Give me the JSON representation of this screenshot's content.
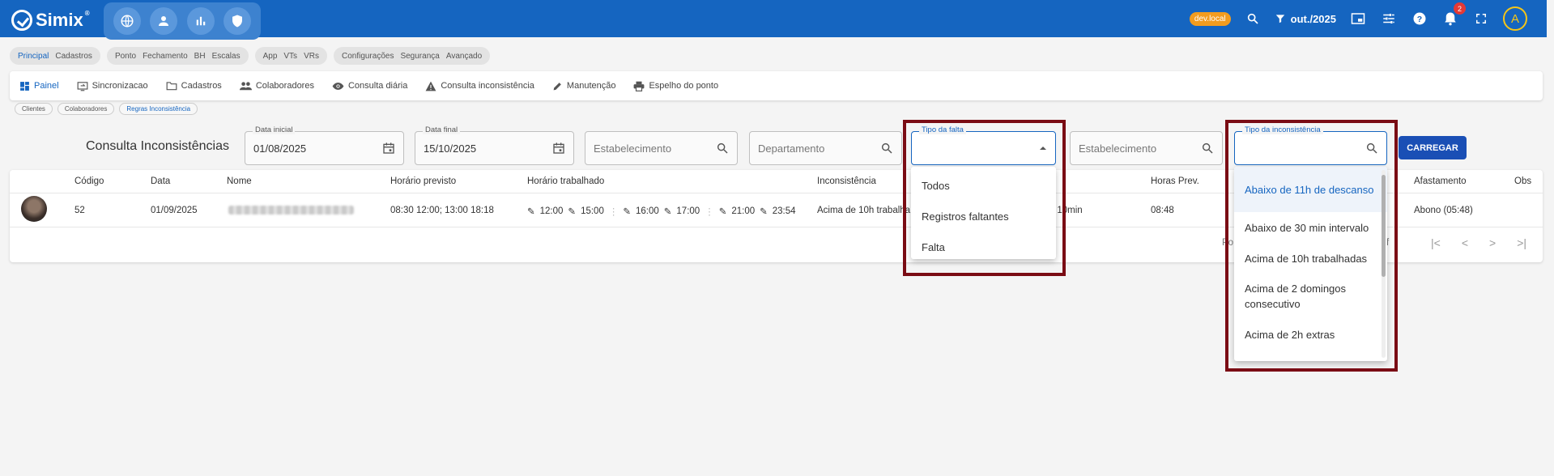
{
  "app": {
    "name": "Simix",
    "logo_sup": "®"
  },
  "topbar": {
    "env_badge": "dev.local",
    "month": "out./2025",
    "notifications": "2",
    "avatar_letter": "A"
  },
  "modules": [
    {
      "items": [
        "Principal",
        "Cadastros"
      ],
      "active": "Principal"
    },
    {
      "items": [
        "Ponto",
        "Fechamento",
        "BH",
        "Escalas"
      ]
    },
    {
      "items": [
        "App",
        "VTs",
        "VRs"
      ]
    },
    {
      "items": [
        "Configurações",
        "Segurança",
        "Avançado"
      ]
    }
  ],
  "nav": {
    "items": [
      {
        "label": "Painel",
        "icon": "dashboard-icon"
      },
      {
        "label": "Sincronizacao",
        "icon": "sync-icon"
      },
      {
        "label": "Cadastros",
        "icon": "folder-icon"
      },
      {
        "label": "Colaboradores",
        "icon": "people-icon"
      },
      {
        "label": "Consulta diária",
        "icon": "eye-icon"
      },
      {
        "label": "Consulta inconsistência",
        "icon": "warning-icon"
      },
      {
        "label": "Manutenção",
        "icon": "pencil-icon"
      },
      {
        "label": "Espelho do ponto",
        "icon": "print-icon"
      }
    ]
  },
  "breadcrumbs": [
    "Clientes",
    "Colaboradores",
    "Regras Inconsistência"
  ],
  "filters": {
    "title": "Consulta Inconsistências",
    "data_inicial_label": "Data inicial",
    "data_inicial": "01/08/2025",
    "data_final_label": "Data final",
    "data_final": "15/10/2025",
    "estabelecimento_placeholder": "Estabelecimento",
    "departamento_placeholder": "Departamento",
    "tipo_falta_label": "Tipo da falta",
    "estabelecimento2_placeholder": "Estabelecimento",
    "tipo_inconsistencia_label": "Tipo da inconsistência",
    "load_button": "CARREGAR"
  },
  "table": {
    "headers": {
      "codigo": "Código",
      "data": "Data",
      "nome": "Nome",
      "horario_previsto": "Horário previsto",
      "horario_trabalhado": "Horário trabalhado",
      "inconsistencia": "Inconsistência",
      "horas_prev": "Horas Prev.",
      "afastamento": "Afastamento",
      "obs": "Obs"
    },
    "row": {
      "codigo": "52",
      "data": "01/09/2025",
      "horario_previsto": "08:30 12:00; 13:00 18:18",
      "punches": [
        "12:00",
        "15:00",
        "16:00",
        "17:00",
        "21:00",
        "23:54"
      ],
      "inconsistencia": "Acima de 10h trabalha",
      "inconsistencia_tail": "ox de 10min",
      "horas_prev": "08:48",
      "afastamento": "Abono (05:48)"
    },
    "pager_left": "Po",
    "pager_right": "f"
  },
  "dropdown_falta": {
    "options": [
      "Todos",
      "Registros faltantes",
      "Falta"
    ]
  },
  "dropdown_inconsistencia": {
    "options": [
      "Abaixo de 11h de descanso",
      "Abaixo de 30 min intervalo",
      "Acima de 10h trabalhadas",
      "Acima de 2 domingos consecutivo",
      "Acima de 2h extras"
    ],
    "highlighted": 0
  },
  "colors": {
    "primary": "#1565c0",
    "highlight_box": "#7a0c14",
    "env_badge": "#f29c1f"
  }
}
